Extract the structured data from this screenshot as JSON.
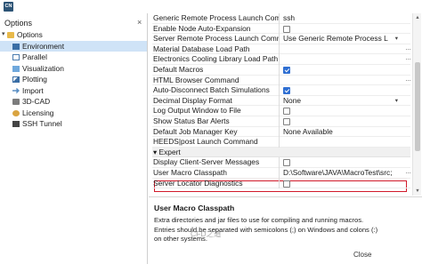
{
  "app": {
    "icon_text": "CN"
  },
  "left_panel": {
    "title": "Options",
    "close_glyph": "×",
    "tree": [
      {
        "label": "Options",
        "icon": "folder-icon",
        "expanded": true,
        "selected": false
      },
      {
        "label": "Environment",
        "icon": "environment-icon",
        "selected": true
      },
      {
        "label": "Parallel",
        "icon": "parallel-icon",
        "selected": false
      },
      {
        "label": "Visualization",
        "icon": "visualization-icon",
        "selected": false
      },
      {
        "label": "Plotting",
        "icon": "plotting-icon",
        "selected": false
      },
      {
        "label": "Import",
        "icon": "import-icon",
        "selected": false
      },
      {
        "label": "3D-CAD",
        "icon": "3d-cad-icon",
        "selected": false
      },
      {
        "label": "Licensing",
        "icon": "licensing-icon",
        "selected": false
      },
      {
        "label": "SSH Tunnel",
        "icon": "ssh-tunnel-icon",
        "selected": false
      }
    ]
  },
  "properties": {
    "rows": [
      {
        "name": "Generic Remote Process Launch Command",
        "value": "ssh",
        "type": "text"
      },
      {
        "name": "Enable Node Auto-Expansion",
        "type": "checkbox",
        "checked": false
      },
      {
        "name": "Server Remote Process Launch Command",
        "value": "Use Generic Remote Process L",
        "type": "dropdown"
      },
      {
        "name": "Material Database Load Path",
        "value": "",
        "type": "text",
        "button": "..."
      },
      {
        "name": "Electronics Cooling Library Load Path",
        "value": "",
        "type": "text",
        "button": "..."
      },
      {
        "name": "Default Macros",
        "type": "checkbox",
        "checked": true
      },
      {
        "name": "HTML Browser Command",
        "value": "",
        "type": "text",
        "button": "..."
      },
      {
        "name": "Auto-Disconnect Batch Simulations",
        "type": "checkbox",
        "checked": true
      },
      {
        "name": "Decimal Display Format",
        "value": "None",
        "type": "dropdown"
      },
      {
        "name": "Log Output Window to File",
        "type": "checkbox",
        "checked": false
      },
      {
        "name": "Show Status Bar Alerts",
        "type": "checkbox",
        "checked": false
      },
      {
        "name": "Default Job Manager Key",
        "value": "None Available",
        "type": "text"
      },
      {
        "name": "HEEDS|post Launch Command",
        "value": "",
        "type": "text"
      },
      {
        "name": "Expert",
        "type": "category"
      },
      {
        "name": "Display Client-Server Messages",
        "type": "checkbox",
        "checked": false
      },
      {
        "name": "User Macro Classpath",
        "value": "D:\\Software\\JAVA\\MacroTest\\src;",
        "type": "text",
        "button": "...",
        "highlighted": true
      },
      {
        "name": "Server Locator Diagnostics",
        "type": "checkbox",
        "checked": false
      }
    ]
  },
  "description": {
    "title": "User Macro Classpath",
    "text": "Extra directories and jar files to use for compiling and running macros. Entries should be separated with semicolons (;) on Windows and colons (:) on other systems.",
    "close_label": "Close"
  },
  "watermark": {
    "text": "CFD之道"
  },
  "colors": {
    "selection": "#cfe3f7",
    "highlight_border": "#d11a2a",
    "checkbox_checked": "#2f6fd2"
  }
}
